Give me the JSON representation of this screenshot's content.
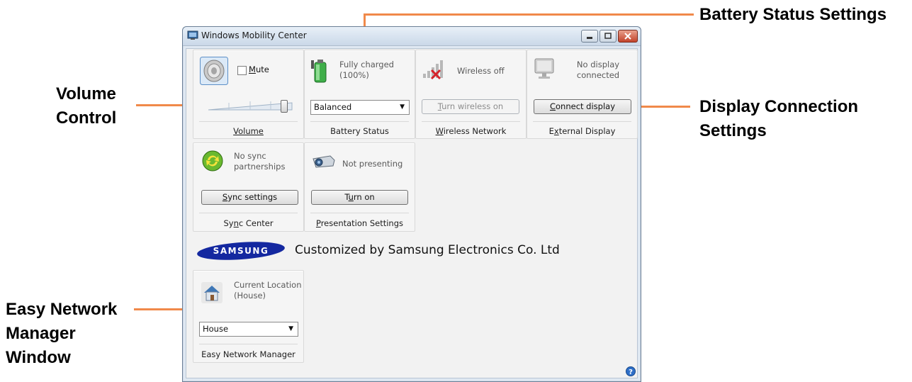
{
  "window": {
    "title": "Windows Mobility Center"
  },
  "callouts": {
    "volume_control_1": "Volume",
    "volume_control_2": "Control",
    "battery_status_settings": "Battery Status Settings",
    "display_connection_1": "Display Connection",
    "display_connection_2": "Settings",
    "easy_network_1": "Easy Network",
    "easy_network_2": "Manager",
    "easy_network_3": "Window"
  },
  "tiles": {
    "volume": {
      "mute_label_pre": "",
      "mute_key": "M",
      "mute_rest": "ute",
      "mute_checked": false,
      "level": 0.88,
      "label": "Volume"
    },
    "battery": {
      "status_line1": "Fully charged",
      "status_line2": "(100%)",
      "plan_selected": "Balanced",
      "label": "Battery Status"
    },
    "wireless": {
      "status": "Wireless off",
      "button_key": "T",
      "button_rest": "urn wireless on",
      "label_key": "W",
      "label_rest": "ireless Network"
    },
    "display": {
      "status_line1": "No display",
      "status_line2": "connected",
      "button_key": "C",
      "button_rest": "onnect display",
      "label_pre": "E",
      "label_key": "x",
      "label_rest": "ternal Display"
    },
    "sync": {
      "status_line1": "No sync",
      "status_line2": "partnerships",
      "button_key": "S",
      "button_rest": "ync settings",
      "label_pre": "Sy",
      "label_key": "n",
      "label_rest": "c Center"
    },
    "presentation": {
      "status": "Not presenting",
      "button_pre": "T",
      "button_key": "u",
      "button_rest": "rn on",
      "label_key": "P",
      "label_rest": "resentation Settings"
    },
    "network": {
      "status_line1": "Current Location",
      "status_line2": "(House)",
      "location_selected": "House",
      "label": "Easy Network Manager"
    }
  },
  "samsung": {
    "logo_text": "SAMSUNG",
    "customized_text": "Customized by Samsung Electronics Co. Ltd"
  },
  "colors": {
    "callout_line": "#f0894a",
    "samsung_blue": "#1428a0"
  },
  "icons": {
    "help": "help-icon"
  }
}
